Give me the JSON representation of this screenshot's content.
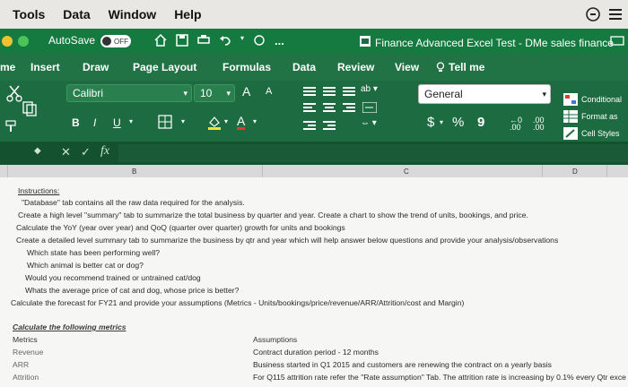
{
  "menu": {
    "items": [
      "Tools",
      "Data",
      "Window",
      "Help"
    ]
  },
  "titlebar": {
    "autosave_label": "AutoSave",
    "autosave_state": "OFF",
    "more_label": "...",
    "document_title": "Finance Advanced Excel Test - DMe sales finance"
  },
  "tabs": [
    "me",
    "Insert",
    "Draw",
    "Page Layout",
    "Formulas",
    "Data",
    "Review",
    "View",
    "Tell me"
  ],
  "ribbon": {
    "font_name": "Calibri",
    "font_size": "10",
    "bold": "B",
    "italic": "I",
    "underline": "U",
    "grow_font": "A",
    "shrink_font": "A",
    "font_color": "A",
    "number_format": "General",
    "currency": "$",
    "percent": "%",
    "comma": "9",
    "increase_decimal": ".00",
    "decrease_decimal": ".00",
    "conditional_formatting": "Conditional",
    "format_as_table": "Format as",
    "cell_styles": "Cell Styles"
  },
  "formula_bar": {
    "fx": "fx",
    "cancel": "✕",
    "confirm": "✓",
    "value": ""
  },
  "columns": [
    "B",
    "C",
    "D"
  ],
  "sheet": {
    "instructions_header": "Instructions:",
    "lines": [
      "\"Database\" tab contains all the raw data required for the analysis.",
      "Create a high level \"summary\" tab to summarize the total business by quarter and year. Create a chart to show the trend of units, bookings, and price.",
      "Calculate the YoY (year over year) and QoQ (quarter over quarter) growth for units and bookings",
      "Create a detailed level summary tab to summarize the business by qtr and year which will help answer below questions and provide your analysis/observations",
      "Which state has been performing well?",
      "Which animal is better cat or dog?",
      "Would you recommend trained or untrained cat/dog",
      "Whats the average price of cat and dog, whose price is better?",
      "Calculate the forecast for FY21 and provide your assumptions (Metrics - Units/bookings/price/revenue/ARR/Attrition/cost and Margin)"
    ],
    "metrics_header": "Calculate the following metrics",
    "metrics_label": "Metrics",
    "metrics": [
      "Revenue",
      "ARR",
      "Attrition"
    ],
    "assumptions_label": "Assumptions",
    "assumptions": [
      "Contract duration period - 12 months",
      "Business started in Q1 2015 and customers are renewing the contract on a yearly basis",
      "For Q115 attrition rate refer the \"Rate assumption\" Tab. The attrition rate is increasing by 0.1% every Qtr exce"
    ]
  }
}
